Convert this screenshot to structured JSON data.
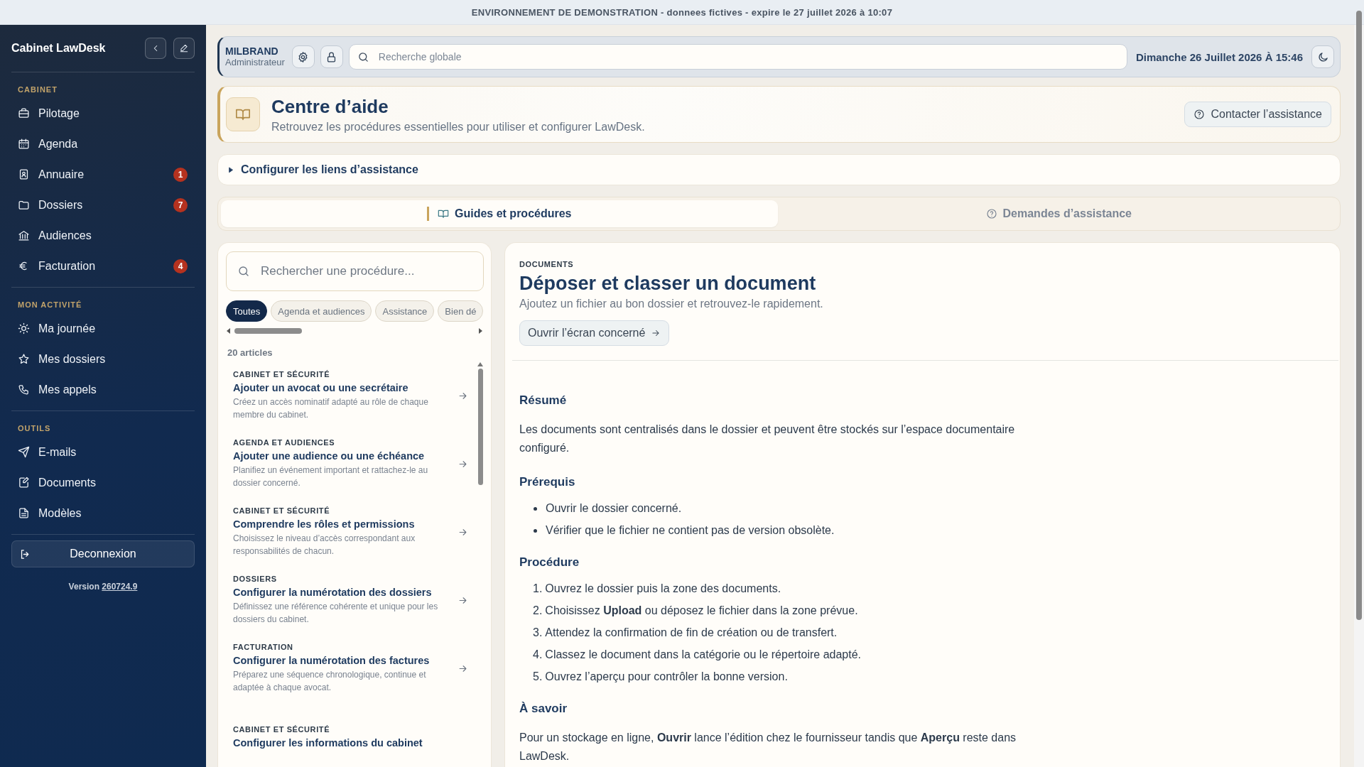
{
  "banner": {
    "text": "ENVIRONNEMENT DE DEMONSTRATION - donnees fictives - expire le 27 juillet 2026 à 10:07"
  },
  "sidebar": {
    "title": "Cabinet LawDesk",
    "sections": [
      {
        "label": "CABINET",
        "items": [
          {
            "label": "Pilotage"
          },
          {
            "label": "Agenda"
          },
          {
            "label": "Annuaire",
            "badge": "1"
          },
          {
            "label": "Dossiers",
            "badge": "7"
          },
          {
            "label": "Audiences"
          },
          {
            "label": "Facturation",
            "badge": "4"
          }
        ]
      },
      {
        "label": "MON ACTIVITÉ",
        "items": [
          {
            "label": "Ma journée"
          },
          {
            "label": "Mes dossiers"
          },
          {
            "label": "Mes appels"
          }
        ]
      },
      {
        "label": "OUTILS",
        "items": [
          {
            "label": "E-mails"
          },
          {
            "label": "Documents"
          },
          {
            "label": "Modèles"
          }
        ]
      }
    ],
    "logout": "Deconnexion",
    "version_label": "Version",
    "version": "260724.9"
  },
  "topbar": {
    "user": {
      "name": "MILBRAND",
      "role": "Administrateur"
    },
    "search": {
      "placeholder": "Recherche globale"
    },
    "datetime": "Dimanche 26 Juillet 2026 À 15:46"
  },
  "header": {
    "title": "Centre d’aide",
    "subtitle": "Retrouvez les procédures essentielles pour utiliser et configurer LawDesk.",
    "button": "Contacter l’assistance"
  },
  "help_links": {
    "label": "Configurer les liens d’assistance",
    "expanded": false
  },
  "tabs": [
    {
      "label": "Guides et procédures",
      "selected": true
    },
    {
      "label": "Demandes d’assistance",
      "selected": false
    }
  ],
  "procedures": {
    "search": {
      "placeholder": "Rechercher une procédure..."
    },
    "filters": [
      {
        "label": "Toutes",
        "selected": true
      },
      {
        "label": "Agenda et audiences",
        "selected": false
      },
      {
        "label": "Assistance",
        "selected": false
      },
      {
        "label": "Bien dé",
        "selected": false
      }
    ],
    "count": "20 articles",
    "articles": [
      {
        "category": "CABINET ET SÉCURITÉ",
        "title": "Ajouter un avocat ou une secrétaire",
        "description": "Créez un accès nominatif adapté au rôle de chaque membre du cabinet."
      },
      {
        "category": "AGENDA ET AUDIENCES",
        "title": "Ajouter une audience ou une échéance",
        "description": "Planifiez un événement important et rattachez-le au dossier concerné."
      },
      {
        "category": "CABINET ET SÉCURITÉ",
        "title": "Comprendre les rôles et permissions",
        "description": "Choisissez le niveau d’accès correspondant aux responsabilités de chacun."
      },
      {
        "category": "DOSSIERS",
        "title": "Configurer la numérotation des dossiers",
        "description": "Définissez une référence cohérente et unique pour les dossiers du cabinet."
      },
      {
        "category": "FACTURATION",
        "title": "Configurer la numérotation des factures",
        "description": "Préparez une séquence chronologique, continue et adaptée à chaque avocat."
      },
      {
        "category": "CABINET ET SÉCURITÉ",
        "title": "Configurer les informations du cabinet"
      }
    ]
  },
  "article": {
    "category": "DOCUMENTS",
    "title": "Déposer et classer un document",
    "subtitle": "Ajoutez un fichier au bon dossier et retrouvez-le rapidement.",
    "button": "Ouvrir l’écran concerné",
    "sections": [
      {
        "kind": "paragraph",
        "heading": "Résumé",
        "text": "Les documents sont centralisés dans le dossier et peuvent être stockés sur l’espace documentaire configuré."
      },
      {
        "kind": "bullets",
        "heading": "Prérequis",
        "items": [
          "Ouvrir le dossier concerné.",
          "Vérifier que le fichier ne contient pas de version obsolète."
        ]
      },
      {
        "kind": "steps",
        "heading": "Procédure",
        "items": [
          {
            "number": "1.",
            "text": "Ouvrez le dossier puis la zone des documents."
          },
          {
            "number": "2.",
            "text": "Choisissez **Upload** ou déposez le fichier dans la zone prévue."
          },
          {
            "number": "3.",
            "text": "Attendez la confirmation de fin de création ou de transfert."
          },
          {
            "number": "4.",
            "text": "Classez le document dans la catégorie ou le répertoire adapté."
          },
          {
            "number": "5.",
            "text": "Ouvrez l’aperçu pour contrôler la bonne version."
          }
        ]
      },
      {
        "kind": "paragraph",
        "heading": "À savoir",
        "text": "Pour un stockage en ligne, **Ouvrir** lance l’édition chez le fournisseur tandis que **Aperçu** reste dans LawDesk."
      }
    ]
  }
}
